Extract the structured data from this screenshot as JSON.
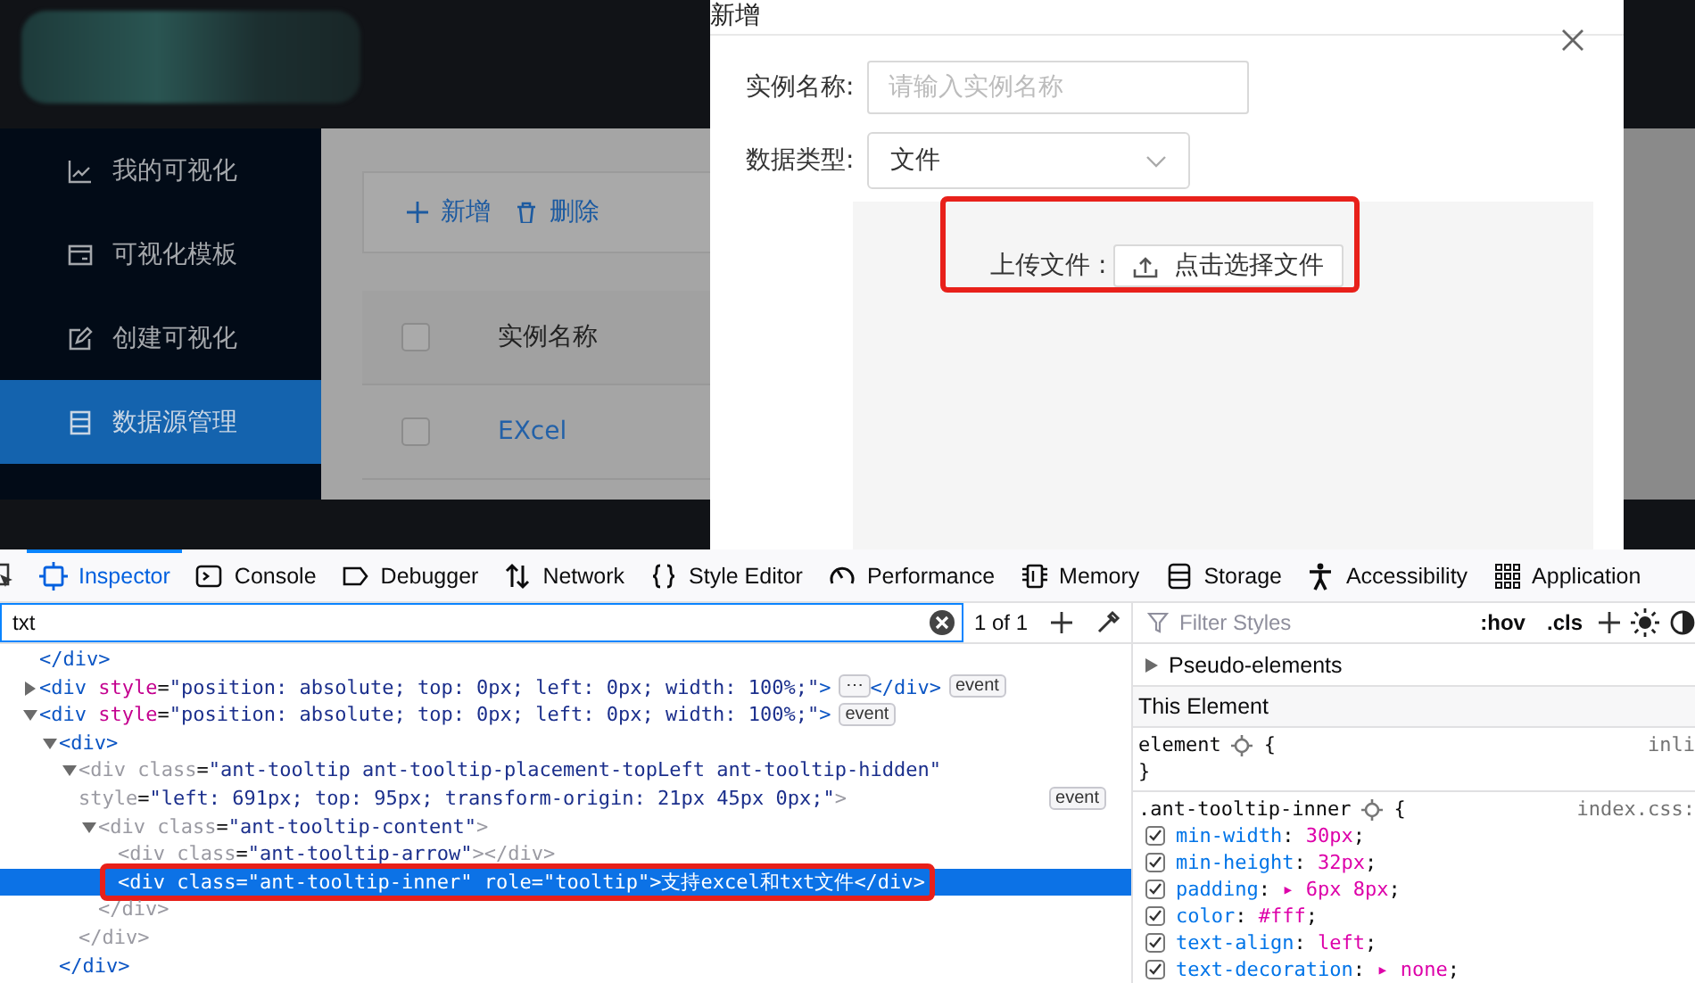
{
  "app": {
    "sidebar": {
      "items": [
        {
          "label": "我的可视化",
          "selected": false
        },
        {
          "label": "可视化模板",
          "selected": false
        },
        {
          "label": "创建可视化",
          "selected": false
        },
        {
          "label": "数据源管理",
          "selected": true
        }
      ]
    },
    "toolbar": {
      "buttons": [
        {
          "label": "新增"
        },
        {
          "label": "删除"
        }
      ]
    },
    "table": {
      "header_checked": false,
      "columns": [
        "实例名称"
      ],
      "rows": [
        {
          "checked": false,
          "cells": [
            "EXcel"
          ]
        }
      ]
    }
  },
  "modal": {
    "title": "新增",
    "fields": [
      {
        "kind": "input",
        "label": "实例名称:",
        "placeholder": "请输入实例名称"
      },
      {
        "kind": "select",
        "label": "数据类型:",
        "value": "文件"
      }
    ],
    "upload": {
      "label": "上传文件 :",
      "button": "点击选择文件"
    }
  },
  "devtools": {
    "tabs": [
      {
        "label": "Inspector",
        "selected": true
      },
      {
        "label": "Console",
        "selected": false
      },
      {
        "label": "Debugger",
        "selected": false
      },
      {
        "label": "Network",
        "selected": false
      },
      {
        "label": "Style Editor",
        "selected": false
      },
      {
        "label": "Performance",
        "selected": false
      },
      {
        "label": "Memory",
        "selected": false
      },
      {
        "label": "Storage",
        "selected": false
      },
      {
        "label": "Accessibility",
        "selected": false
      },
      {
        "label": "Application",
        "selected": false
      }
    ],
    "search": {
      "value": "txt",
      "result": "1 of 1"
    },
    "styles_filter": {
      "placeholder": "Filter Styles",
      "buttons": [
        ":hov",
        ".cls"
      ]
    },
    "markup": [
      {
        "kind": "leaf",
        "markup": "</div>",
        "selected": false,
        "dimmed": false
      },
      {
        "kind": "parent",
        "markup": "<div style=\"position: absolute; top: 0px; left: 0px; width: 100%;\">",
        "expanded": false,
        "ellipsis": "⋯",
        "end": "</div>",
        "badge": "event",
        "selected": false,
        "dimmed": false
      },
      {
        "kind": "parent",
        "markup": "<div style=\"position: absolute; top: 0px; left: 0px; width: 100%;\">",
        "expanded": true,
        "badge": "event",
        "selected": false,
        "dimmed": false,
        "children": [
          {
            "kind": "parent",
            "markup": "<div>",
            "expanded": true,
            "end": "</div>",
            "selected": false,
            "dimmed": false,
            "children": [
              {
                "kind": "parent",
                "markup": "<div class=\"ant-tooltip ant-tooltip-placement-topLeft ant-tooltip-hidden\" style=\"left: 691px; top: 95px; transform-origin: 21px 45px 0px;\">",
                "expanded": true,
                "badge": "event",
                "end": "</div>",
                "selected": false,
                "dimmed": true,
                "children": [
                  {
                    "kind": "parent",
                    "markup": "<div class=\"ant-tooltip-content\">",
                    "expanded": true,
                    "end": "</div>",
                    "selected": false,
                    "dimmed": true,
                    "children": [
                      {
                        "kind": "leaf",
                        "markup": "<div class=\"ant-tooltip-arrow\"></div>",
                        "selected": false,
                        "dimmed": true
                      },
                      {
                        "kind": "leaf",
                        "markup": "<div class=\"ant-tooltip-inner\" role=\"tooltip\">支持excel和txt文件</div>",
                        "selected": true,
                        "dimmed": false
                      }
                    ]
                  }
                ]
              }
            ]
          }
        ]
      }
    ],
    "rule_sections": [
      {
        "kind": "collapsible",
        "label": "Pseudo-elements",
        "expanded": false
      },
      {
        "kind": "header",
        "label": "This Element"
      }
    ],
    "rules": [
      {
        "selector": "element",
        "open": "{",
        "source": "inli",
        "close": "}"
      },
      {
        "selector": ".ant-tooltip-inner",
        "open": "{",
        "source": "index.css:",
        "declarations": [
          {
            "text": "min-width: 30px;",
            "enabled": true
          },
          {
            "text": "min-height: 32px;",
            "enabled": true
          },
          {
            "text": "padding: ▸ 6px 8px;",
            "enabled": true
          },
          {
            "text": "color: #fff;",
            "enabled": true
          },
          {
            "text": "text-align: left;",
            "enabled": true
          },
          {
            "text": "text-decoration: ▸ none;",
            "enabled": true
          }
        ]
      }
    ]
  }
}
